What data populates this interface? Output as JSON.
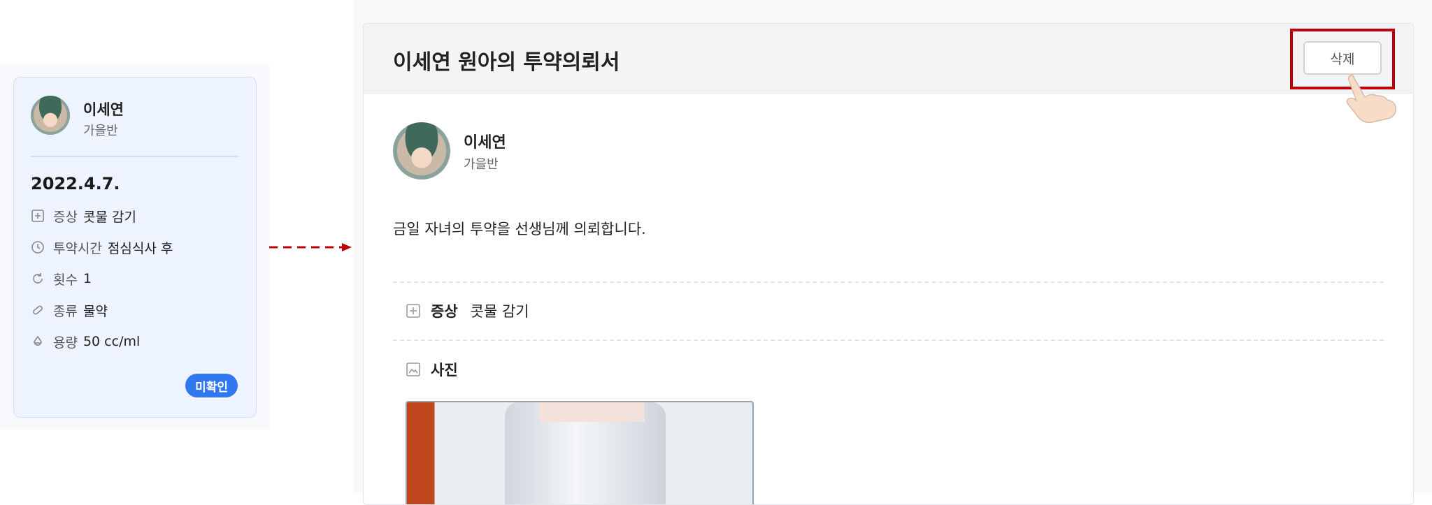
{
  "summary_card": {
    "name": "이세연",
    "class": "가을반",
    "date": "2022.4.7.",
    "rows": [
      {
        "icon": "plus-square-icon",
        "key": "증상",
        "value": "콧물 감기"
      },
      {
        "icon": "clock-icon",
        "key": "투약시간",
        "value": "점심식사 후"
      },
      {
        "icon": "refresh-icon",
        "key": "횟수",
        "value": "1"
      },
      {
        "icon": "pill-icon",
        "key": "종류",
        "value": "물약"
      },
      {
        "icon": "drop-icon",
        "key": "용량",
        "value": "50 cc/ml"
      }
    ],
    "status_badge": "미확인"
  },
  "detail": {
    "title": "이세연 원아의 투약의뢰서",
    "delete_button": "삭제",
    "name": "이세연",
    "class": "가을반",
    "message": "금일 자녀의 투약을 선생님께 의뢰합니다.",
    "symptom_label": "증상",
    "symptom_value": "콧물 감기",
    "photo_label": "사진"
  },
  "colors": {
    "accent": "#2f78f0",
    "highlight": "#c0000b",
    "card_bg": "#eef4ff"
  }
}
